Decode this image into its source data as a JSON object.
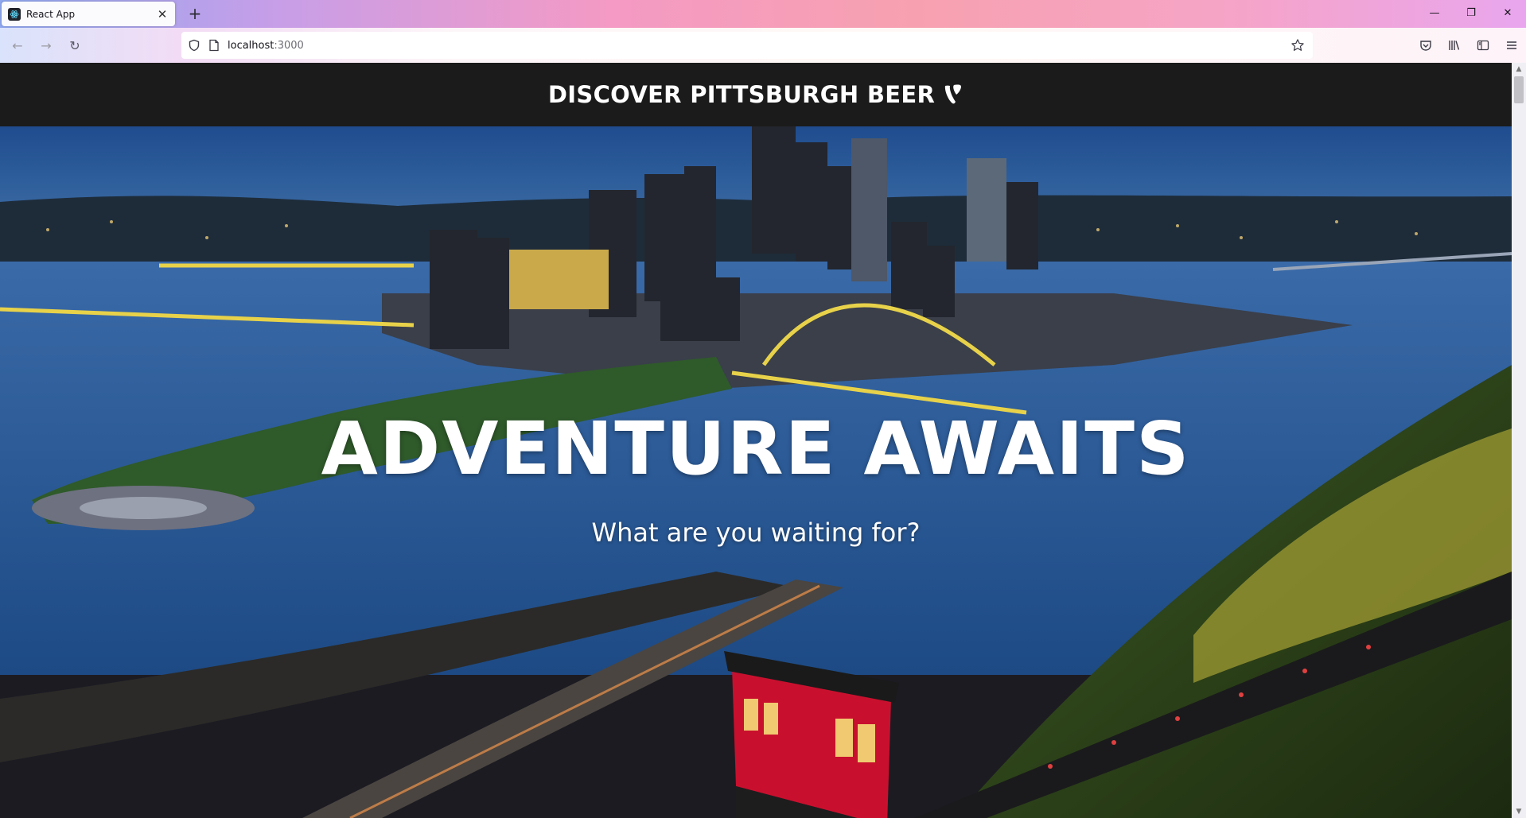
{
  "browser": {
    "tab": {
      "title": "React App",
      "close_label": "✕"
    },
    "new_tab_label": "+",
    "window_controls": {
      "minimize": "—",
      "restore": "❐",
      "close": "✕"
    },
    "url": {
      "host": "localhost",
      "port": ":3000"
    },
    "nav": {
      "back": "←",
      "forward": "→",
      "reload": "↻"
    }
  },
  "site": {
    "title": "DISCOVER PITTSBURGH BEER"
  },
  "hero": {
    "headline": "ADVENTURE AWAITS",
    "subheadline": "What are you waiting for?"
  },
  "scrollbar": {
    "up_arrow": "▲",
    "down_arrow": "▼"
  },
  "colors": {
    "header_bg": "#1b1b1b",
    "header_text": "#ffffff",
    "incline_red": "#c8102e",
    "bridge_yellow": "#e8d24a"
  }
}
